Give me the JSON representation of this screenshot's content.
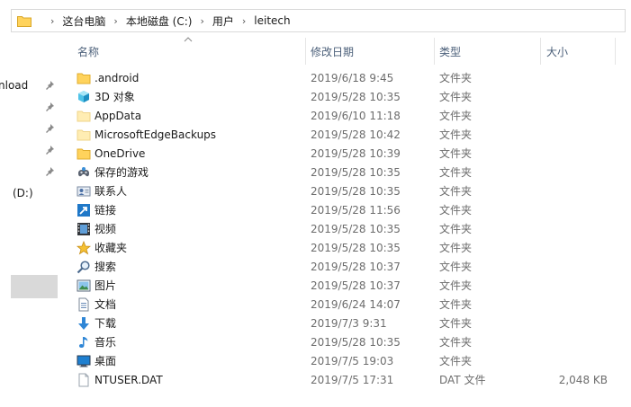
{
  "address": {
    "crumbs": [
      "这台电脑",
      "本地磁盘 (C:)",
      "用户",
      "leitech"
    ]
  },
  "nav": {
    "items": [
      {
        "label": "nload",
        "pinned": true
      },
      {
        "label": "",
        "pinned": true
      },
      {
        "label": "",
        "pinned": true
      },
      {
        "label": "",
        "pinned": true
      },
      {
        "label": "",
        "pinned": true
      },
      {
        "label": "(D:)",
        "pinned": false
      }
    ]
  },
  "columns": {
    "name": "名称",
    "date": "修改日期",
    "type": "类型",
    "size": "大小"
  },
  "files": [
    {
      "name": ".android",
      "date": "2019/6/18 9:45",
      "type": "文件夹",
      "size": "",
      "icon": "folder-icon"
    },
    {
      "name": "3D 对象",
      "date": "2019/5/28 10:35",
      "type": "文件夹",
      "size": "",
      "icon": "3d-objects-icon"
    },
    {
      "name": "AppData",
      "date": "2019/6/10 11:18",
      "type": "文件夹",
      "size": "",
      "icon": "folder-hidden-icon"
    },
    {
      "name": "MicrosoftEdgeBackups",
      "date": "2019/5/28 10:42",
      "type": "文件夹",
      "size": "",
      "icon": "folder-hidden-icon"
    },
    {
      "name": "OneDrive",
      "date": "2019/5/28 10:39",
      "type": "文件夹",
      "size": "",
      "icon": "folder-icon"
    },
    {
      "name": "保存的游戏",
      "date": "2019/5/28 10:35",
      "type": "文件夹",
      "size": "",
      "icon": "saved-games-icon"
    },
    {
      "name": "联系人",
      "date": "2019/5/28 10:35",
      "type": "文件夹",
      "size": "",
      "icon": "contacts-icon"
    },
    {
      "name": "链接",
      "date": "2019/5/28 11:56",
      "type": "文件夹",
      "size": "",
      "icon": "links-icon"
    },
    {
      "name": "视频",
      "date": "2019/5/28 10:35",
      "type": "文件夹",
      "size": "",
      "icon": "videos-icon"
    },
    {
      "name": "收藏夹",
      "date": "2019/5/28 10:35",
      "type": "文件夹",
      "size": "",
      "icon": "favorites-icon"
    },
    {
      "name": "搜索",
      "date": "2019/5/28 10:37",
      "type": "文件夹",
      "size": "",
      "icon": "searches-icon"
    },
    {
      "name": "图片",
      "date": "2019/5/28 10:37",
      "type": "文件夹",
      "size": "",
      "icon": "pictures-icon"
    },
    {
      "name": "文档",
      "date": "2019/6/24 14:07",
      "type": "文件夹",
      "size": "",
      "icon": "documents-icon"
    },
    {
      "name": "下载",
      "date": "2019/7/3 9:31",
      "type": "文件夹",
      "size": "",
      "icon": "downloads-icon"
    },
    {
      "name": "音乐",
      "date": "2019/5/28 10:35",
      "type": "文件夹",
      "size": "",
      "icon": "music-icon"
    },
    {
      "name": "桌面",
      "date": "2019/7/5 19:03",
      "type": "文件夹",
      "size": "",
      "icon": "desktop-icon"
    },
    {
      "name": "NTUSER.DAT",
      "date": "2019/7/5 17:31",
      "type": "DAT 文件",
      "size": "2,048 KB",
      "icon": "file-icon"
    }
  ],
  "colors": {
    "folder": "#ffd35c",
    "folder_dark": "#e0ad2e",
    "header_text": "#4c607a",
    "selected_nav": "#d9d9d9"
  }
}
